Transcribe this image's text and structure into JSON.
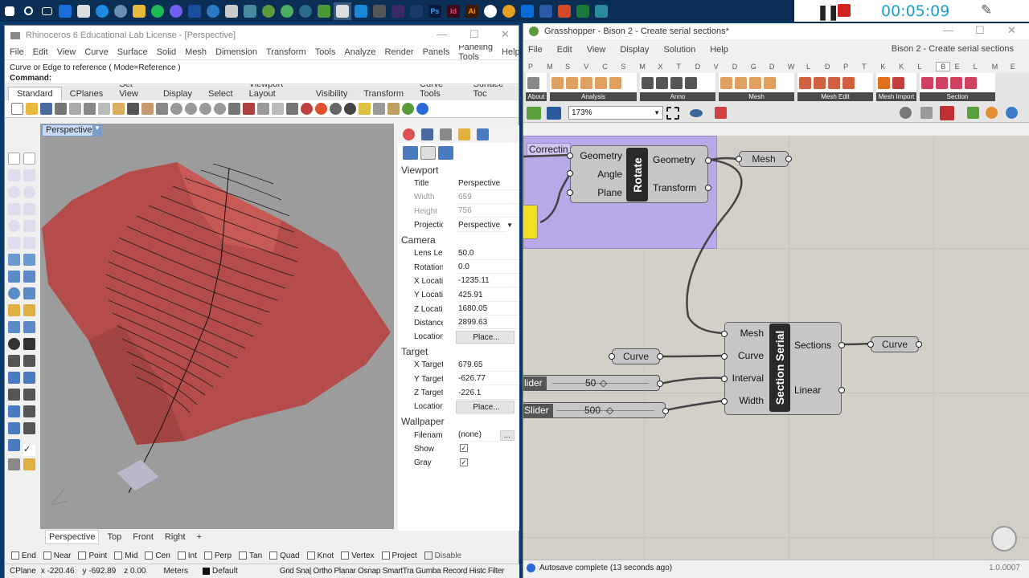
{
  "recorder": {
    "time": "00:05:09"
  },
  "rhino": {
    "title": "Rhinoceros 6 Educational Lab License - [Perspective]",
    "menu": [
      "File",
      "Edit",
      "View",
      "Curve",
      "Surface",
      "Solid",
      "Mesh",
      "Dimension",
      "Transform",
      "Tools",
      "Analyze",
      "Render",
      "Panels",
      "Paneling Tools",
      "Help"
    ],
    "cmd_history": "Curve or Edge to reference ( Mode=Reference )",
    "cmd_prompt": "Command:",
    "toolbar_tabs": [
      "Standard",
      "CPlanes",
      "Set View",
      "Display",
      "Select",
      "Viewport Layout",
      "Visibility",
      "Transform",
      "Curve Tools",
      "Surface Toc"
    ],
    "viewport_label": "Perspective",
    "viewport_tabs": [
      "Perspective",
      "Top",
      "Front",
      "Right"
    ],
    "add_tab": "+",
    "props": {
      "viewport_heading": "Viewport",
      "viewport_rows": [
        {
          "k": "Title",
          "v": "Perspective"
        },
        {
          "k": "Width",
          "v": "659"
        },
        {
          "k": "Height",
          "v": "756"
        },
        {
          "k": "Projection",
          "v": "Perspective"
        }
      ],
      "camera_heading": "Camera",
      "camera_rows": [
        {
          "k": "Lens Length",
          "v": "50.0"
        },
        {
          "k": "Rotation",
          "v": "0.0"
        },
        {
          "k": "X Location",
          "v": "-1235.11"
        },
        {
          "k": "Y Location",
          "v": "425.91"
        },
        {
          "k": "Z Location",
          "v": "1680.05"
        },
        {
          "k": "Distance t...",
          "v": "2899.63"
        },
        {
          "k": "Location",
          "v": "Place..."
        }
      ],
      "target_heading": "Target",
      "target_rows": [
        {
          "k": "X Target",
          "v": "679.65"
        },
        {
          "k": "Y Target",
          "v": "-626.77"
        },
        {
          "k": "Z Target",
          "v": "-226.1"
        },
        {
          "k": "Location",
          "v": "Place..."
        }
      ],
      "wallpaper_heading": "Wallpaper",
      "wallpaper_rows": [
        {
          "k": "Filename",
          "v": "(none)"
        },
        {
          "k": "Show",
          "v": "✓"
        },
        {
          "k": "Gray",
          "v": "✓"
        }
      ],
      "browse": "..."
    },
    "osnaps": [
      "End",
      "Near",
      "Point",
      "Mid",
      "Cen",
      "Int",
      "Perp",
      "Tan",
      "Quad",
      "Knot",
      "Vertex",
      "Project"
    ],
    "disable": "Disable",
    "status": {
      "cplane": "CPlane",
      "x": "x -220.46",
      "y": "y -692.89",
      "z": "z 0.00",
      "units": "Meters",
      "layer": "Default",
      "toggles": "Grid Sna| Ortho  Planar  Osnap  SmartTra  Gumba  Record Histc  Filter"
    }
  },
  "gh": {
    "title": "Grasshopper - Bison 2 - Create serial sections*",
    "menu": [
      "File",
      "Edit",
      "View",
      "Display",
      "Solution",
      "Help"
    ],
    "doc_name": "Bison 2 - Create serial sections",
    "cat_tabs": [
      "P",
      "M",
      "S",
      "V",
      "C",
      "S",
      "M",
      "X",
      "T",
      "D",
      "V",
      "D",
      "G",
      "D",
      "W",
      "L",
      "D",
      "P",
      "T",
      "K",
      "K",
      "L",
      "B",
      "E",
      "L",
      "M",
      "E"
    ],
    "ribbon_groups": [
      "About",
      "Analysis",
      "Anno",
      "Mesh",
      "Mesh Edit",
      "Mesh Import",
      "Section"
    ],
    "zoom": "173%",
    "rotate": {
      "label": "Rotate",
      "inputs": [
        "Geometry",
        "Angle",
        "Plane"
      ],
      "outputs": [
        "Geometry",
        "Transform"
      ],
      "group_label": "Correctin"
    },
    "mesh_param": "Mesh",
    "section": {
      "label": "Section Serial",
      "inputs": [
        "Mesh",
        "Curve",
        "Interval",
        "Width"
      ],
      "outputs": [
        "Sections",
        "Linear"
      ]
    },
    "curve_in": "Curve",
    "curve_out": "Curve",
    "slider1": {
      "label": "lider",
      "value": "50"
    },
    "slider2": {
      "label": "Slider",
      "value": "500"
    },
    "autosave": "Autosave complete (13 seconds ago)",
    "version": "1.0.0007"
  }
}
